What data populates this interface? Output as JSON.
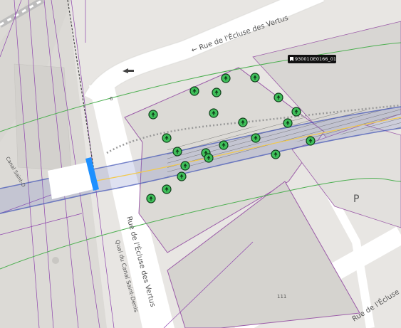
{
  "streets": {
    "rue_ecluse_top": "← Rue de l'Écluse des Vertus",
    "rue_ecluse_left": "Rue de l'Écluse des Vertus",
    "rue_ecluse_br": "Rue de l'Écluse",
    "quai": "Quai du Canal Saint-Denis",
    "canal_left": "Canal Saint-D"
  },
  "labels": {
    "house_number_6": "6",
    "house_number_111": "111",
    "parking": "P"
  },
  "selected_feature": {
    "id": "93001OE0166_01"
  },
  "colors": {
    "tree_fill": "#3fbf5a",
    "tree_stroke": "#0f3d19",
    "bridge_accent": "#1e90ff",
    "tag_bg": "#111111"
  },
  "icons": [
    "tree-marker-icon",
    "bookmark-icon",
    "one-way-arrow-icon"
  ],
  "tree_count": 26
}
